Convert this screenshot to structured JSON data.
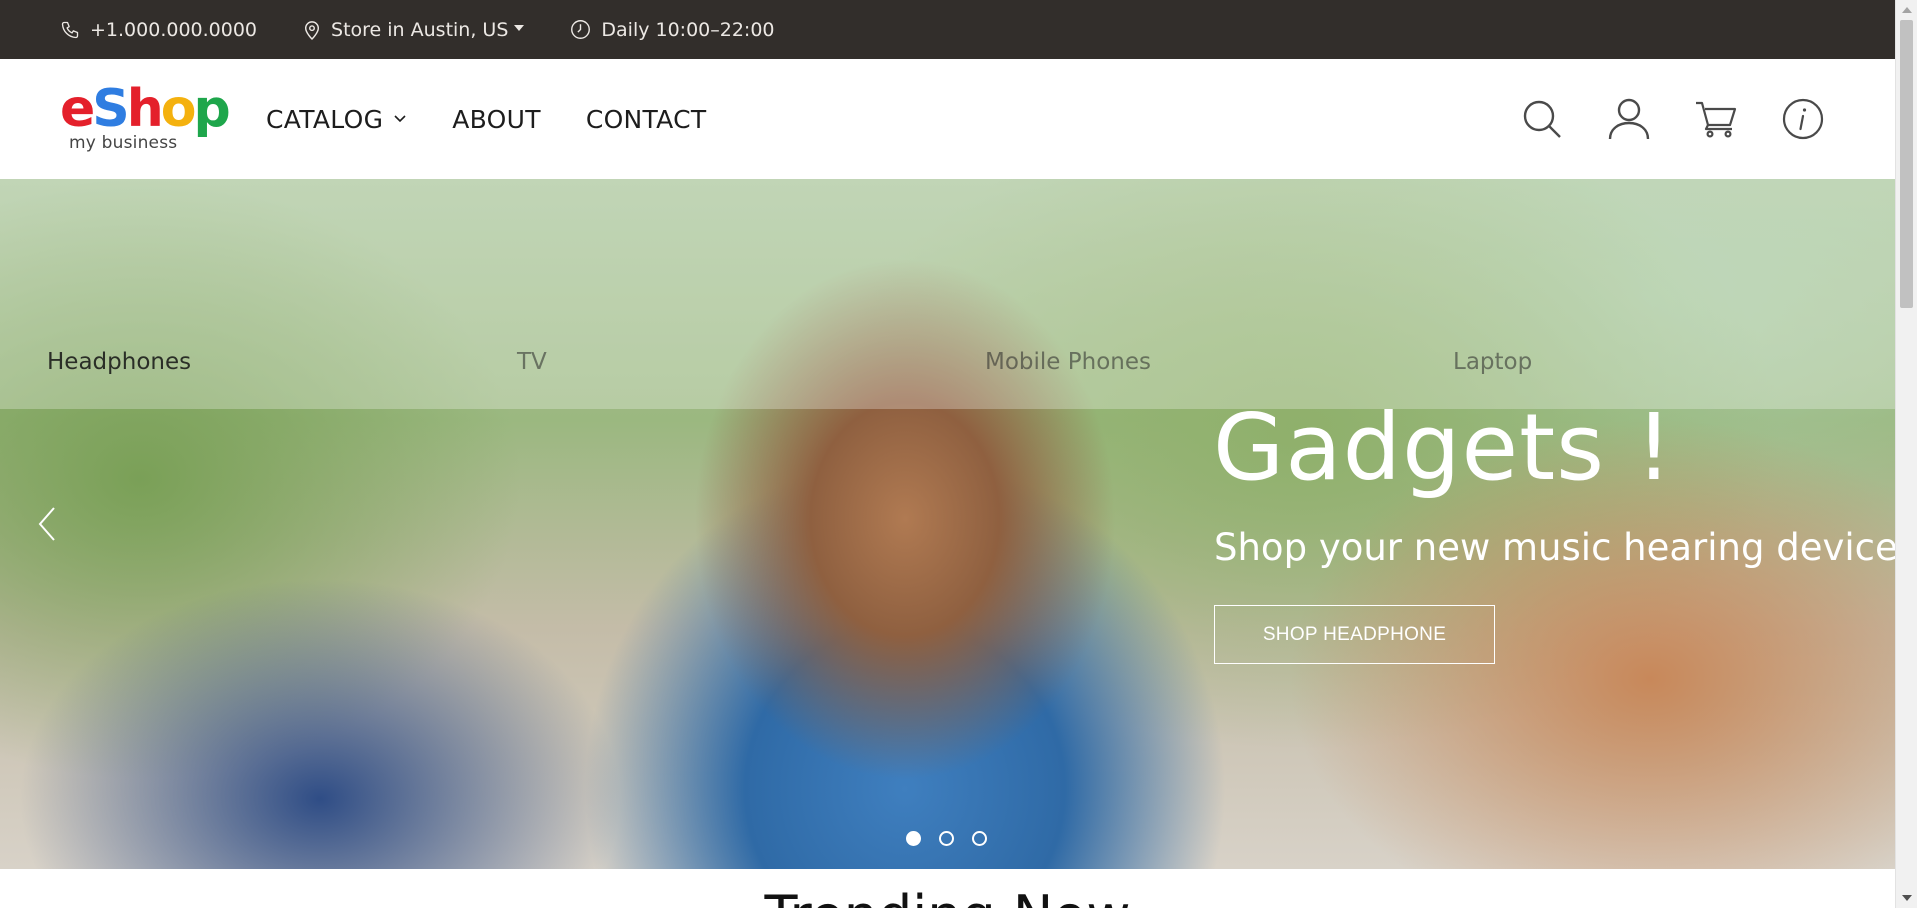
{
  "topbar": {
    "phone": "+1.000.000.0000",
    "store": "Store in Austin, US",
    "hours": "Daily 10:00–22:00",
    "icons": [
      "phone-icon",
      "map-pin-icon",
      "clock-icon"
    ]
  },
  "logo": {
    "letters": [
      "e",
      "S",
      "h",
      "o",
      "p"
    ],
    "tagline": "my business",
    "colors": {
      "red": "#e4202b",
      "blue": "#2f7de1",
      "yellow": "#f4b10e",
      "green": "#1ea64b"
    }
  },
  "nav": {
    "catalog": "CATALOG",
    "about": "ABOUT",
    "contact": "CONTACT"
  },
  "header_icons": [
    "search-icon",
    "user-icon",
    "cart-icon",
    "info-icon"
  ],
  "hero": {
    "tabs": [
      "Headphones",
      "TV",
      "Mobile Phones",
      "Laptop"
    ],
    "active_tab": 0,
    "headline": "Gadgets !",
    "subline": "Shop your new music hearing device",
    "cta_label": "SHOP HEADPHONE",
    "slides": 3,
    "active_slide": 0
  },
  "trending_title": "Trending Now",
  "colors": {
    "topbar_bg": "#322e2b",
    "topbar_text": "#ece8e4",
    "nav_text": "#1d1d1d",
    "hero_text": "#ffffff"
  }
}
